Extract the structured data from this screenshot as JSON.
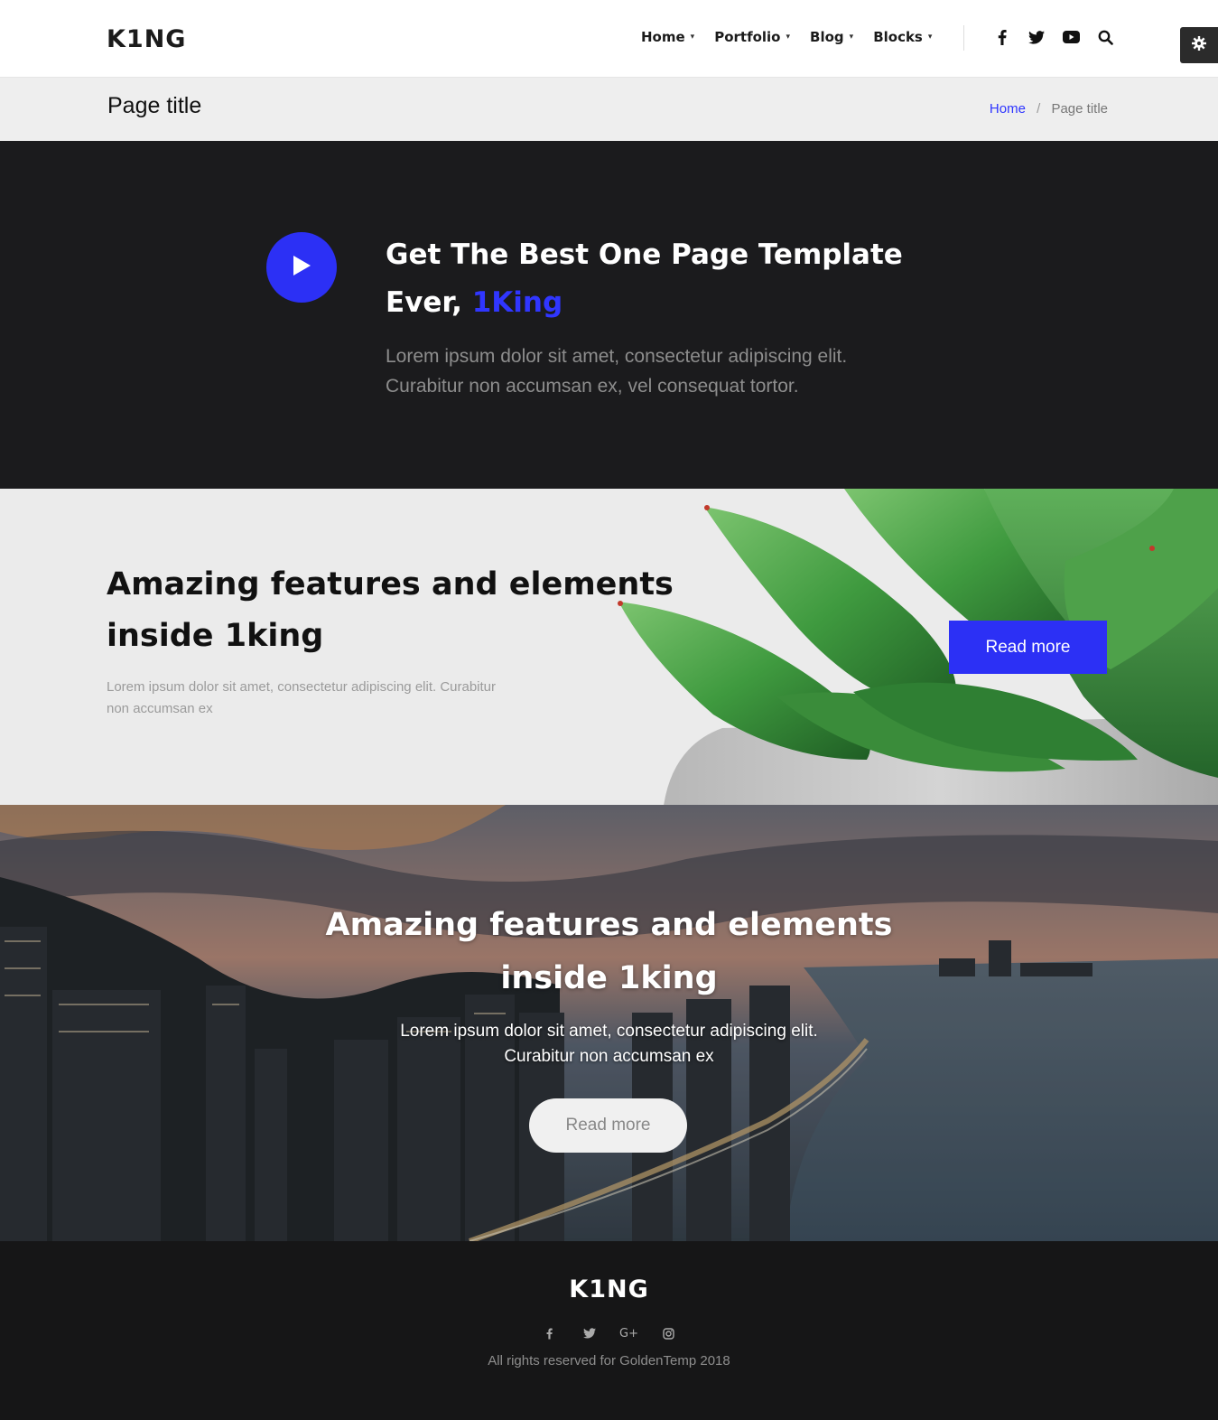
{
  "header": {
    "logo": "K1NG",
    "nav": [
      {
        "label": "Home",
        "icon": "chevron-down-icon"
      },
      {
        "label": "Portfolio",
        "icon": "chevron-down-icon"
      },
      {
        "label": "Blog",
        "icon": "chevron-down-icon"
      },
      {
        "label": "Blocks",
        "icon": "chevron-down-icon"
      }
    ],
    "icons": [
      "facebook-icon",
      "twitter-icon",
      "youtube-icon",
      "search-icon"
    ],
    "settings_icon": "gear-icon"
  },
  "titlebar": {
    "title": "Page title",
    "breadcrumb": {
      "home": "Home",
      "separator": "/",
      "current": "Page title"
    }
  },
  "intro": {
    "title_main": "Get The Best One Page Template Ever, ",
    "title_accent": "1King",
    "text": "Lorem ipsum dolor sit amet, consectetur adipiscing elit. Curabitur non accumsan ex, vel consequat tortor.",
    "accent_color": "#2c30f5",
    "play_icon": "play-icon"
  },
  "plant_section": {
    "title": "Amazing features and elements inside 1king",
    "text": "Lorem ipsum dolor sit amet, consectetur adipiscing elit. Curabitur non accumsan ex",
    "button": "Read more"
  },
  "city_section": {
    "title": "Amazing features and elements inside 1king",
    "text_line1": "Lorem ipsum dolor sit amet, consectetur adipiscing elit.",
    "text_line2": "Curabitur non accumsan ex",
    "button": "Read more"
  },
  "footer": {
    "logo": "K1NG",
    "social": [
      "facebook-icon",
      "twitter-icon",
      "google-plus-icon",
      "instagram-icon"
    ],
    "google_plus_glyph": "G+",
    "copyright": "All rights reserved for GoldenTemp 2018"
  },
  "colors": {
    "accent": "#2c30f5",
    "dark": "#1b1b1d",
    "footer": "#161617",
    "light_gray": "#eeeeee"
  }
}
